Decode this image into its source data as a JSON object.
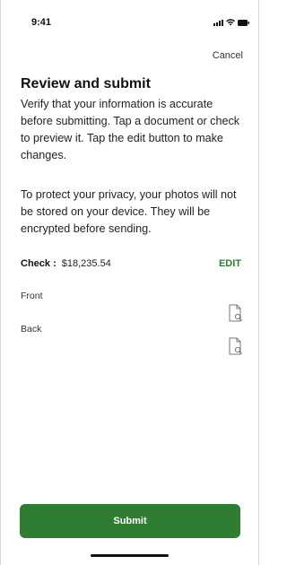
{
  "status_bar": {
    "time": "9:41",
    "icons": [
      "signal-icon",
      "wifi-icon",
      "battery-icon"
    ]
  },
  "header": {
    "cancel_label": "Cancel"
  },
  "content": {
    "title": "Review and submit",
    "intro": "Verify that your information is accurate before submitting. Tap a document or check to preview it. Tap the edit button to make changes.",
    "privacy": "To protect your privacy, your photos will not be stored on your device. They will be encrypted before sending."
  },
  "check": {
    "label": "Check :",
    "amount": "$18,235.54",
    "edit_label": "EDIT"
  },
  "documents": [
    {
      "label": "Front",
      "icon": "document-preview-icon"
    },
    {
      "label": "Back",
      "icon": "document-preview-icon"
    }
  ],
  "footer": {
    "submit_label": "Submit"
  },
  "colors": {
    "accent": "#2e7d32",
    "text": "#222222",
    "background": "#ffffff"
  }
}
